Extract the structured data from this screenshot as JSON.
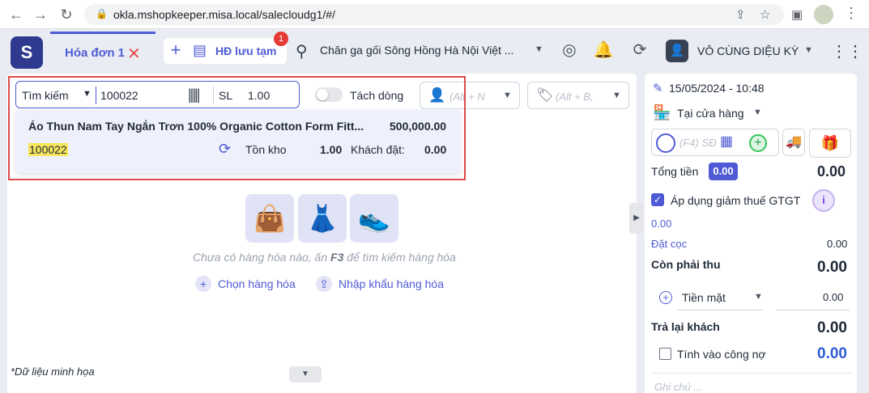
{
  "browser": {
    "url": "okla.mshopkeeper.misa.local/salecloudg1/#/"
  },
  "header": {
    "tab_label": "Hóa đơn 1",
    "draft_label": "HĐ lưu tạm",
    "draft_badge": "1",
    "store_name": "Chăn ga gối Sông Hồng Hà Nội Việt ...",
    "user_name": "VÔ CÙNG DIỆU KỲ"
  },
  "search": {
    "type_label": "Tìm kiếm",
    "value": "100022",
    "qty_label": "SL",
    "qty_value": "1.00",
    "split_label": "Tách dòng",
    "split_enabled": false,
    "employee_placeholder": "(Alt + N",
    "tag_placeholder": "(Alt + B,"
  },
  "result": {
    "product_name": "Áo Thun Nam Tay Ngắn Trơn 100% Organic Cotton Form Fitt...",
    "price": "500,000.00",
    "sku": "100022",
    "stock_label": "Tồn kho",
    "stock_value": "1.00",
    "ordered_label": "Khách đặt:",
    "ordered_value": "0.00"
  },
  "empty_state": {
    "hint_before": "Chưa có hàng hóa nào, ấn ",
    "hint_key": "F3",
    "hint_after": " để tìm kiếm hàng hóa",
    "choose_label": "Chọn hàng hóa",
    "import_label": "Nhập khẩu hàng hóa"
  },
  "demo_note": "*Dữ liệu minh họa",
  "order": {
    "datetime": "15/05/2024 - 10:48",
    "sale_mode": "Tại cửa hàng",
    "customer_placeholder": "(F4) SĐ",
    "total_label": "Tổng tiền",
    "total_badge": "0.00",
    "total_value": "0.00",
    "tax_label": "Áp dụng giảm thuế GTGT",
    "tax_value": "0.00",
    "deposit_label": "Đặt cọc",
    "deposit_value": "0.00",
    "due_label": "Còn phải thu",
    "due_value": "0.00",
    "pay_method": "Tiền mặt",
    "pay_value": "0.00",
    "change_label": "Trả lại khách",
    "change_value": "0.00",
    "debt_label": "Tính vào công nợ",
    "debt_value": "0.00",
    "note_placeholder": "Ghi chú ..."
  },
  "colors": {
    "accent": "#4f5bd5",
    "highlight_border": "#e04b4b",
    "badge_red": "#e53935"
  }
}
